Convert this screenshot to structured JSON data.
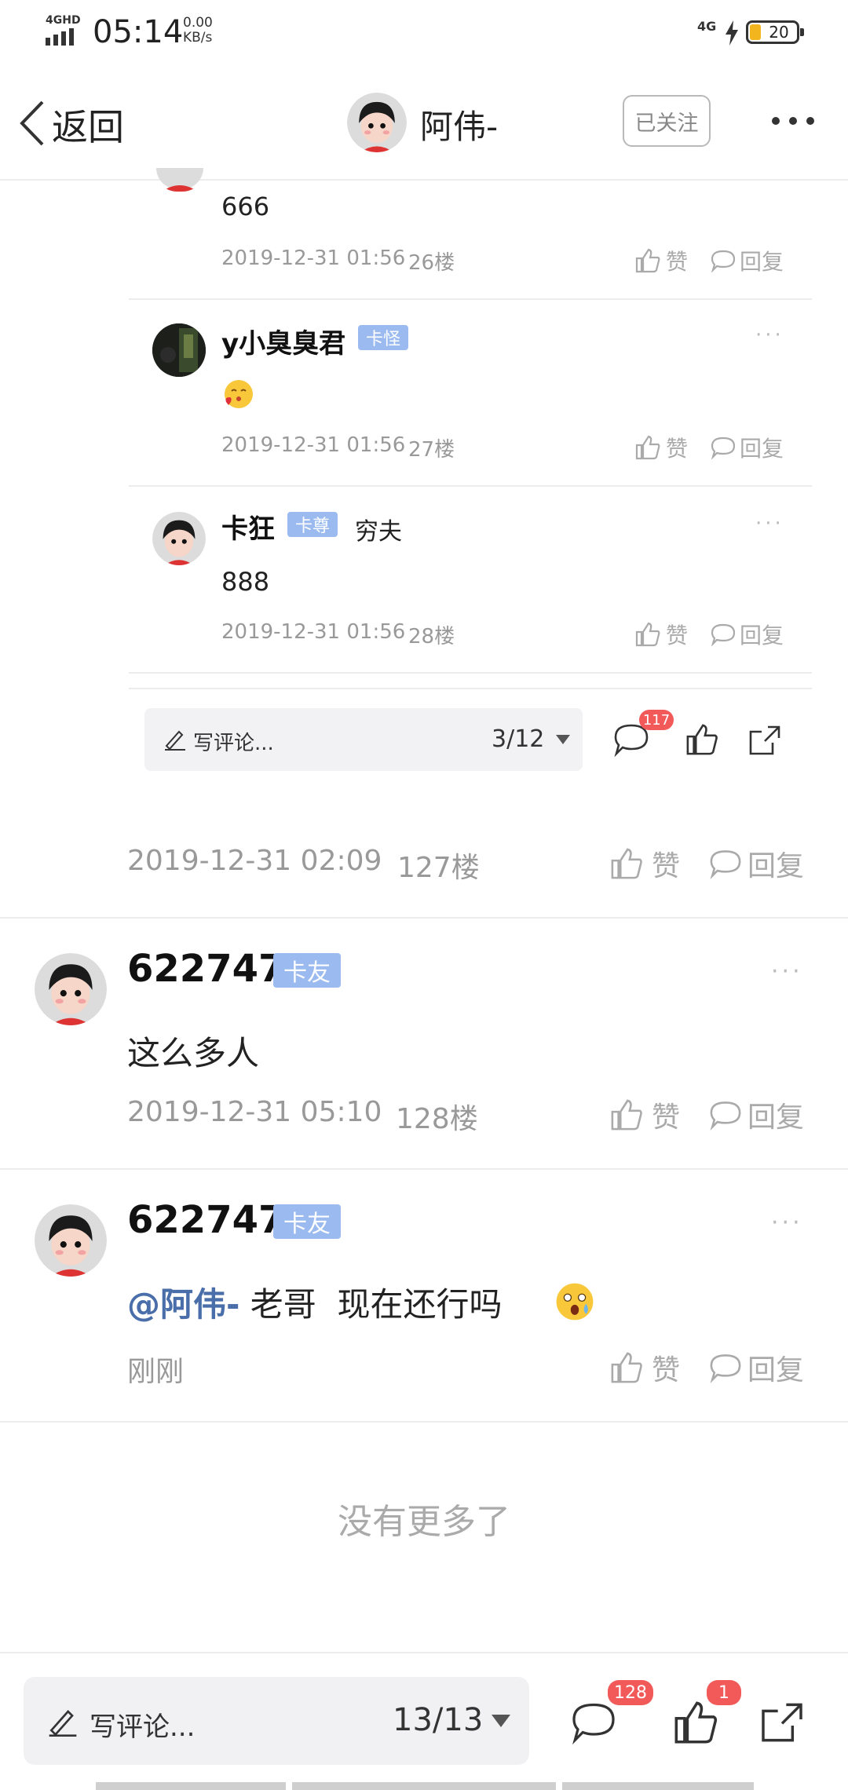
{
  "status_bar": {
    "network": "4GHD",
    "time": "05:14",
    "speed_value": "0.00",
    "speed_unit": "KB/s",
    "cell": "4G",
    "battery": "20"
  },
  "header": {
    "back_label": "返回",
    "title": "阿伟-",
    "follow_label": "已关注"
  },
  "sub_replies": [
    {
      "content": "666",
      "time": "2019-12-31 01:56",
      "floor": "26楼",
      "like": "赞",
      "reply": "回复"
    },
    {
      "nickname": "y小臭臭君",
      "badge": "卡怪",
      "time": "2019-12-31 01:56",
      "floor": "27楼",
      "like": "赞",
      "reply": "回复"
    },
    {
      "nickname": "卡狂",
      "badge": "卡尊",
      "extra_tag": "穷夫",
      "content": "888",
      "time": "2019-12-31 01:56",
      "floor": "28楼",
      "like": "赞",
      "reply": "回复"
    }
  ],
  "sub_toolbar": {
    "placeholder": "写评论...",
    "page": "3/12",
    "comment_count": "117"
  },
  "post_127": {
    "time": "2019-12-31 02:09",
    "floor": "127楼",
    "like": "赞",
    "reply": "回复"
  },
  "posts": [
    {
      "nickname": "622747",
      "badge": "卡友",
      "content": "这么多人",
      "time": "2019-12-31 05:10",
      "floor": "128楼",
      "like": "赞",
      "reply": "回复"
    },
    {
      "nickname": "622747",
      "badge": "卡友",
      "mention": "@阿伟-",
      "content": " 老哥  现在还行吗",
      "time": "刚刚",
      "like": "赞",
      "reply": "回复"
    }
  ],
  "end_notice": "没有更多了",
  "bottom_bar": {
    "placeholder": "写评论...",
    "page": "13/13",
    "comment_count": "128",
    "like_count": "1"
  }
}
